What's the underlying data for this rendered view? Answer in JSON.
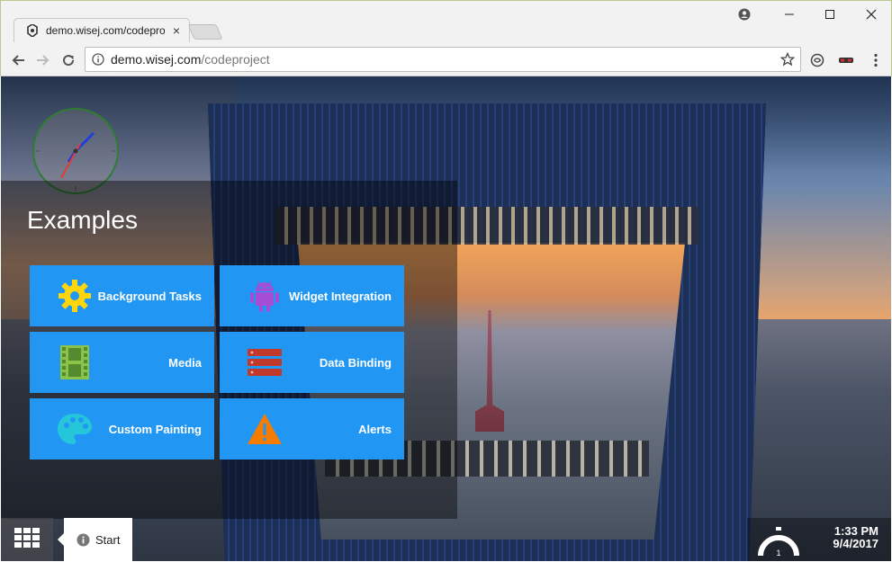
{
  "browser": {
    "tab_title": "demo.wisej.com/codeproject",
    "url_host": "demo.wisej.com",
    "url_path": "/codeproject"
  },
  "panel": {
    "title": "Examples",
    "tiles": [
      {
        "label": "Background Tasks",
        "icon": "gear-icon",
        "color": "#ffd60a"
      },
      {
        "label": "Widget Integration",
        "icon": "android-icon",
        "color": "#a64dd6"
      },
      {
        "label": "Media",
        "icon": "film-icon",
        "color": "#8bc34a"
      },
      {
        "label": "Data Binding",
        "icon": "database-icon",
        "color": "#c0392b"
      },
      {
        "label": "Custom Painting",
        "icon": "palette-icon",
        "color": "#26c6da"
      },
      {
        "label": "Alerts",
        "icon": "warning-icon",
        "color": "#f57c00"
      }
    ]
  },
  "taskbar": {
    "start_label": "Start",
    "time": "1:33 PM",
    "date": "9/4/2017",
    "gauge_value": "1"
  },
  "colors": {
    "tile": "#2196f3"
  }
}
